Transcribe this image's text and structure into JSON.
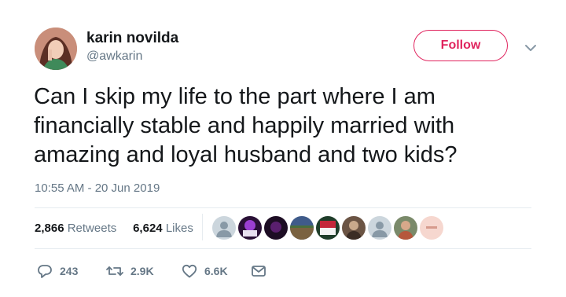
{
  "author": {
    "name": "karin novilda",
    "handle": "@awkarin",
    "avatar_icon": "profile-photo"
  },
  "follow_button_label": "Follow",
  "menu_icon": "chevron-down-icon",
  "tweet": {
    "lines": [
      "Can I skip my life to the part where I am",
      "financially stable and happily married with",
      "amazing and loyal husband and two kids?"
    ],
    "timestamp": "10:55 AM - 20 Jun 2019"
  },
  "stats": {
    "retweets_count": "2,866",
    "retweets_label": "Retweets",
    "likes_count": "6,624",
    "likes_label": "Likes"
  },
  "likers": [
    {
      "kind": "default-avatar"
    },
    {
      "kind": "purple-avatar"
    },
    {
      "kind": "dark-avatar"
    },
    {
      "kind": "landscape-avatar"
    },
    {
      "kind": "flag-avatar"
    },
    {
      "kind": "sepia-avatar"
    },
    {
      "kind": "default-avatar"
    },
    {
      "kind": "outdoor-avatar"
    },
    {
      "kind": "pink-avatar"
    }
  ],
  "actions": {
    "replies": "243",
    "retweets": "2.9K",
    "likes": "6.6K"
  },
  "colors": {
    "follow_accent": "#e0245e",
    "secondary_text": "#657786",
    "primary_text": "#14171a",
    "divider": "#e6ecf0"
  }
}
